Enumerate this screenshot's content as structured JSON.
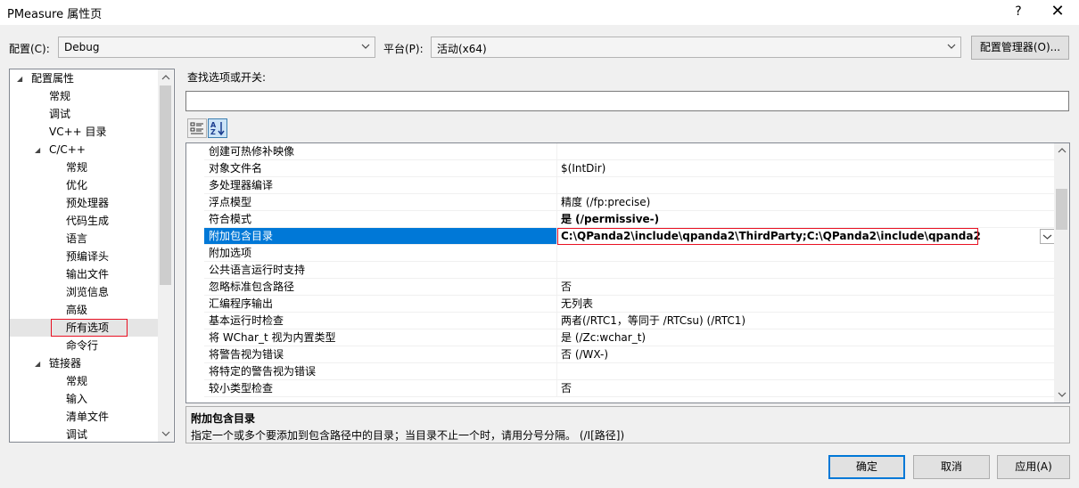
{
  "window": {
    "title": "PMeasure 属性页",
    "help": "?",
    "close": "✕"
  },
  "config": {
    "config_label": "配置(C):",
    "config_value": "Debug",
    "platform_label": "平台(P):",
    "platform_value": "活动(x64)",
    "manager_button": "配置管理器(O)..."
  },
  "tree": {
    "items": [
      {
        "label": "配置属性",
        "caret": "◢"
      },
      {
        "label": "常规"
      },
      {
        "label": "调试"
      },
      {
        "label": "VC++ 目录"
      },
      {
        "label": "C/C++",
        "caret": "◢"
      },
      {
        "label": "常规"
      },
      {
        "label": "优化"
      },
      {
        "label": "预处理器"
      },
      {
        "label": "代码生成"
      },
      {
        "label": "语言"
      },
      {
        "label": "预编译头"
      },
      {
        "label": "输出文件"
      },
      {
        "label": "浏览信息"
      },
      {
        "label": "高级"
      },
      {
        "label": "所有选项",
        "selected": true
      },
      {
        "label": "命令行"
      },
      {
        "label": "链接器",
        "caret": "◢"
      },
      {
        "label": "常规"
      },
      {
        "label": "输入"
      },
      {
        "label": "清单文件"
      },
      {
        "label": "调试"
      }
    ]
  },
  "search": {
    "label": "查找选项或开关:",
    "value": ""
  },
  "toolbar": {
    "categorized_icon": "categorized-icon",
    "alphabetical_icon": "alphabetical-sort-icon"
  },
  "grid": {
    "rows": [
      {
        "name": "创建可热修补映像",
        "value": ""
      },
      {
        "name": "对象文件名",
        "value": "$(IntDir)"
      },
      {
        "name": "多处理器编译",
        "value": ""
      },
      {
        "name": "浮点模型",
        "value": "精度 (/fp:precise)"
      },
      {
        "name": "符合模式",
        "value": "是 (/permissive-)",
        "bold": true
      },
      {
        "name": "附加包含目录",
        "value": "C:\\QPanda2\\include\\qpanda2\\ThirdParty;C:\\QPanda2\\include\\qpanda2",
        "bold": true,
        "selected": true
      },
      {
        "name": "附加选项",
        "value": ""
      },
      {
        "name": "公共语言运行时支持",
        "value": ""
      },
      {
        "name": "忽略标准包含路径",
        "value": "否"
      },
      {
        "name": "汇编程序输出",
        "value": "无列表"
      },
      {
        "name": "基本运行时检查",
        "value": "两者(/RTC1，等同于 /RTCsu) (/RTC1)"
      },
      {
        "name": "将 WChar_t 视为内置类型",
        "value": "是 (/Zc:wchar_t)"
      },
      {
        "name": "将警告视为错误",
        "value": "否 (/WX-)"
      },
      {
        "name": "将特定的警告视为错误",
        "value": ""
      },
      {
        "name": "较小类型检查",
        "value": "否"
      }
    ]
  },
  "description": {
    "title": "附加包含目录",
    "text": "指定一个或多个要添加到包含路径中的目录；当目录不止一个时，请用分号分隔。     (/I[路径])"
  },
  "buttons": {
    "ok": "确定",
    "cancel": "取消",
    "apply": "应用(A)"
  },
  "colors": {
    "selection": "#0078d7",
    "highlight_box": "#e81123"
  }
}
